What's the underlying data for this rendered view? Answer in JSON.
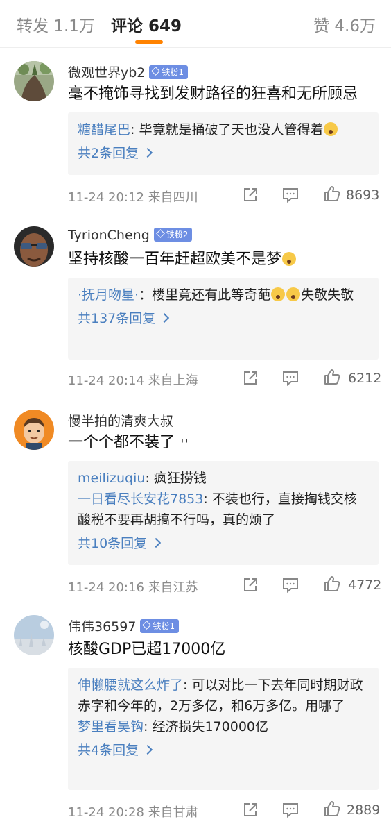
{
  "tabs": {
    "repost": "转发 1.1万",
    "comment": "评论 649",
    "like": "赞 4.6万"
  },
  "colors": {
    "accent": "#ff8200",
    "link": "#4a7fbf",
    "badge": "#6d8ee3"
  },
  "comments": [
    {
      "username": "微观世界yb2",
      "badge": "铁粉1",
      "text": "毫不掩饰寻找到发财路径的狂喜和无所顾忌",
      "reply_name": "糖醋尾巴",
      "reply_text": "毕竟就是捅破了天也没人管得着",
      "reply_more": "共2条回复",
      "time": "11-24 20:12",
      "location": "来自四川",
      "likes": "8693"
    },
    {
      "username": "TyrionCheng",
      "badge": "铁粉2",
      "text": "坚持核酸一百年赶超欧美不是梦",
      "reply_name": "·抚月吻星·",
      "reply_text": "楼里竟还有此等奇葩",
      "reply_text_2": "失敬失敬",
      "reply_more": "共137条回复",
      "time": "11-24 20:14",
      "location": "来自上海",
      "likes": "6212"
    },
    {
      "username": "慢半拍的清爽大叔",
      "text": "一个个都不装了",
      "replies": [
        {
          "name": "meilizuqiu",
          "text": "疯狂捞钱"
        },
        {
          "name": "一日看尽长安花7853",
          "text": "不装也行，直接掏钱交核酸税不要再胡搞不行吗，真的烦了"
        }
      ],
      "reply_more": "共10条回复",
      "time": "11-24 20:16",
      "location": "来自江苏",
      "likes": "4772"
    },
    {
      "username": "伟伟36597",
      "badge": "铁粉1",
      "text": "核酸GDP已超17000亿",
      "replies": [
        {
          "name": "伸懒腰就这么炸了",
          "text": "可以对比一下去年同时期财政赤字和今年的，2万多亿，和6万多亿。用哪了"
        },
        {
          "name": "梦里看吴钩",
          "text": "经济损失170000亿"
        }
      ],
      "reply_more": "共4条回复",
      "time": "11-24 20:28",
      "location": "来自甘肃",
      "likes": "2889"
    }
  ]
}
